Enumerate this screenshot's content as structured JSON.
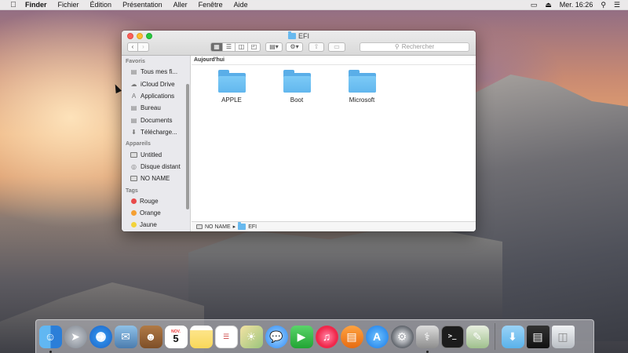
{
  "menubar": {
    "app_name": "Finder",
    "items": [
      "Fichier",
      "Édition",
      "Présentation",
      "Aller",
      "Fenêtre",
      "Aide"
    ],
    "clock": "Mer. 16:26"
  },
  "window": {
    "title": "EFI",
    "search_placeholder": "Rechercher",
    "sidebar": {
      "favorites_header": "Favoris",
      "favorites": [
        {
          "label": "Tous mes fi...",
          "icon": "all-files-icon"
        },
        {
          "label": "iCloud Drive",
          "icon": "cloud-icon"
        },
        {
          "label": "Applications",
          "icon": "applications-icon"
        },
        {
          "label": "Bureau",
          "icon": "desktop-icon"
        },
        {
          "label": "Documents",
          "icon": "documents-icon"
        },
        {
          "label": "Télécharge...",
          "icon": "downloads-icon"
        }
      ],
      "devices_header": "Appareils",
      "devices": [
        {
          "label": "Untitled",
          "icon": "disk-icon"
        },
        {
          "label": "Disque distant",
          "icon": "remote-disc-icon"
        },
        {
          "label": "NO NAME",
          "icon": "disk-icon"
        }
      ],
      "tags_header": "Tags",
      "tags": [
        {
          "label": "Rouge",
          "color": "#e84a4a"
        },
        {
          "label": "Orange",
          "color": "#f5a033"
        },
        {
          "label": "Jaune",
          "color": "#f2d33b"
        }
      ]
    },
    "group_header": "Aujourd'hui",
    "files": [
      {
        "name": "APPLE"
      },
      {
        "name": "Boot"
      },
      {
        "name": "Microsoft"
      }
    ],
    "path": [
      "NO NAME",
      "EFI"
    ]
  },
  "dock": {
    "apps": [
      "finder",
      "launchpad",
      "safari",
      "mail",
      "contacts",
      "calendar",
      "notes",
      "reminders",
      "photos",
      "messages",
      "facetime",
      "itunes",
      "ibooks",
      "app-store",
      "system-preferences",
      "disk-utility",
      "terminal",
      "script-editor"
    ],
    "calendar": {
      "month": "NOV.",
      "day": "5"
    }
  }
}
